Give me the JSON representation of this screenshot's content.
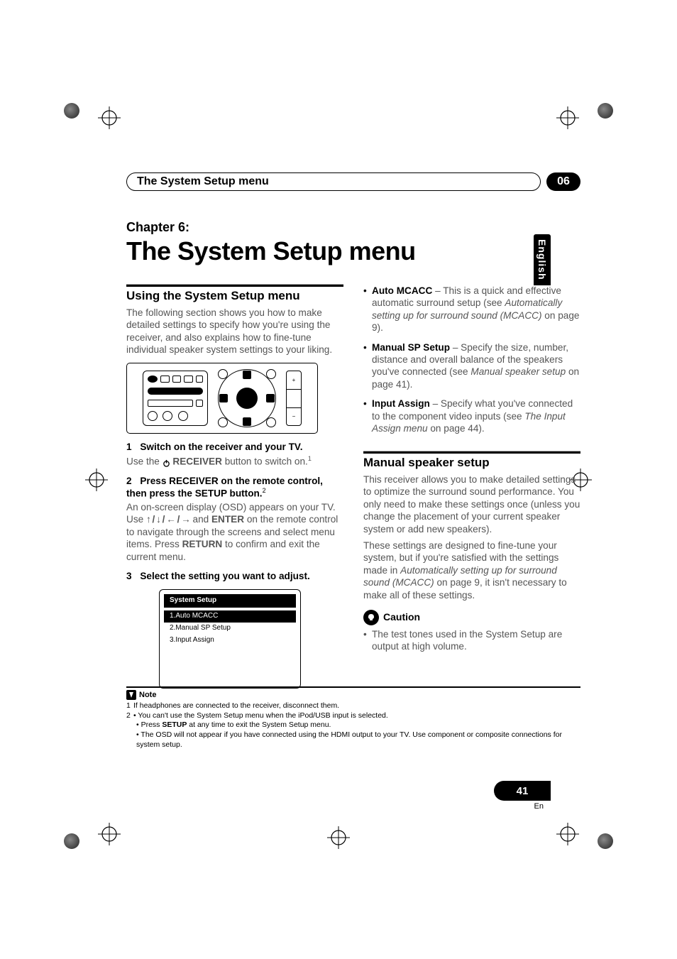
{
  "header": {
    "running_title": "The System Setup menu",
    "chapter_number_badge": "06"
  },
  "lang_tab": "English",
  "page_badge": {
    "number": "41",
    "lang": "En"
  },
  "chapter": {
    "label": "Chapter 6:",
    "title": "The System Setup menu"
  },
  "left": {
    "section1_heading": "Using the System Setup menu",
    "intro_para": "The following section shows you how to make detailed settings to specify how you're using the receiver, and also explains how to fine-tune individual speaker system settings to your liking.",
    "step1_num": "1",
    "step1_text": "Switch on the receiver and your TV.",
    "step1_body_pre": "Use the ",
    "step1_body_bold": "RECEIVER",
    "step1_body_post": " button to switch on.",
    "step1_sup": "1",
    "step2_num": "2",
    "step2_text_a": "Press RECEIVER on the remote control, then press the SETUP button.",
    "step2_sup": "2",
    "step2_body_a": "An on-screen display (OSD) appears on your TV. Use ",
    "step2_body_arrows": "↑ / ↓ / ← / →",
    "step2_body_b": " and ",
    "step2_body_enter": "ENTER",
    "step2_body_c": " on the remote control to navigate through the screens and select menu items. Press ",
    "step2_body_return": "RETURN",
    "step2_body_d": " to confirm and exit the current menu.",
    "step3_num": "3",
    "step3_text": "Select the setting you want to adjust.",
    "osd_title": "System Setup",
    "osd_items": [
      "1.Auto MCACC",
      "2.Manual SP Setup",
      "3.Input Assign"
    ]
  },
  "right": {
    "bul1_lead": "Auto MCACC",
    "bul1_body": " – This is a quick and effective automatic surround setup (see ",
    "bul1_em": "Automatically setting up for surround sound (MCACC)",
    "bul1_tail": " on page 9).",
    "bul2_lead": "Manual SP Setup",
    "bul2_body": " – Specify the size, number, distance and overall balance of the speakers you've connected (see ",
    "bul2_em": "Manual speaker setup",
    "bul2_tail": " on page 41).",
    "bul3_lead": "Input Assign",
    "bul3_body": " – Specify what you've connected to the component video inputs (see ",
    "bul3_em": "The Input Assign menu",
    "bul3_tail": " on page 44).",
    "section2_heading": "Manual speaker setup",
    "ms_para1": "This receiver allows you to make detailed settings to optimize the surround sound performance. You only need to make these settings once (unless you change the placement of your current speaker system or add new speakers).",
    "ms_para2_a": "These settings are designed to fine-tune your system, but if you're satisfied with the settings made in ",
    "ms_para2_em": "Automatically setting up for surround sound (MCACC)",
    "ms_para2_b": " on page 9, it isn't necessary to make all of these settings.",
    "caution_label": "Caution",
    "caution_bullet": "The test tones used in the System Setup are output at high volume."
  },
  "footnotes": {
    "note_label": "Note",
    "fn1": "If headphones are connected to the receiver, disconnect them.",
    "fn2a": "You can't use the System Setup menu when the iPod/USB input is selected.",
    "fn2b_pre": "Press ",
    "fn2b_bold": "SETUP",
    "fn2b_post": " at any time to exit the System Setup menu.",
    "fn2c": "The OSD will not appear if you have connected using the HDMI output to your TV. Use component or composite connections for system setup."
  }
}
